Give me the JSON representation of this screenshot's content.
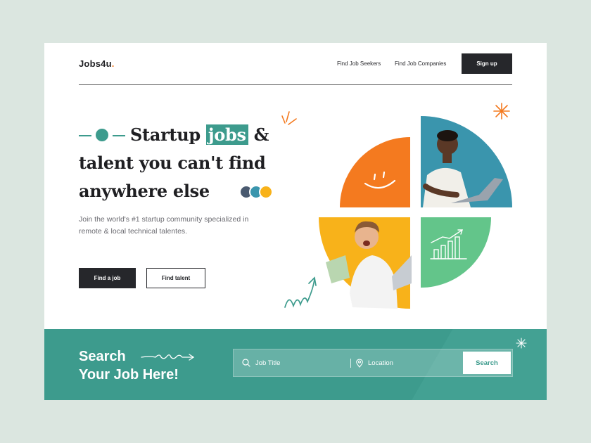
{
  "header": {
    "logo_text": "Jobs4u",
    "logo_dot": ".",
    "nav": [
      "Find Job Seekers",
      "Find Job Companies"
    ],
    "signup_label": "Sign up"
  },
  "hero": {
    "headline_word1": "Startup",
    "headline_highlight": "jobs",
    "headline_amp": "&",
    "headline_line2": "talent you can't find",
    "headline_line3": "anywhere else",
    "subtext": "Join the world's #1 startup community specialized in remote & local technical talentes.",
    "primary_button": "Find a job",
    "secondary_button": "Find talent"
  },
  "search": {
    "title_line1": "Search",
    "title_line2": "Your Job Here!",
    "job_title_placeholder": "Job Title",
    "location_placeholder": "Location",
    "button_label": "Search"
  },
  "colors": {
    "accent": "#3d9b8d",
    "orange": "#f47a1f",
    "yellow": "#f8b21a",
    "blue": "#3a95ad",
    "green": "#63c58a",
    "dark": "#26272b"
  },
  "icons": [
    "search-icon",
    "location-pin-icon",
    "smile-icon",
    "growth-chart-icon",
    "sparkle-icon",
    "squiggle-arrow-icon"
  ]
}
